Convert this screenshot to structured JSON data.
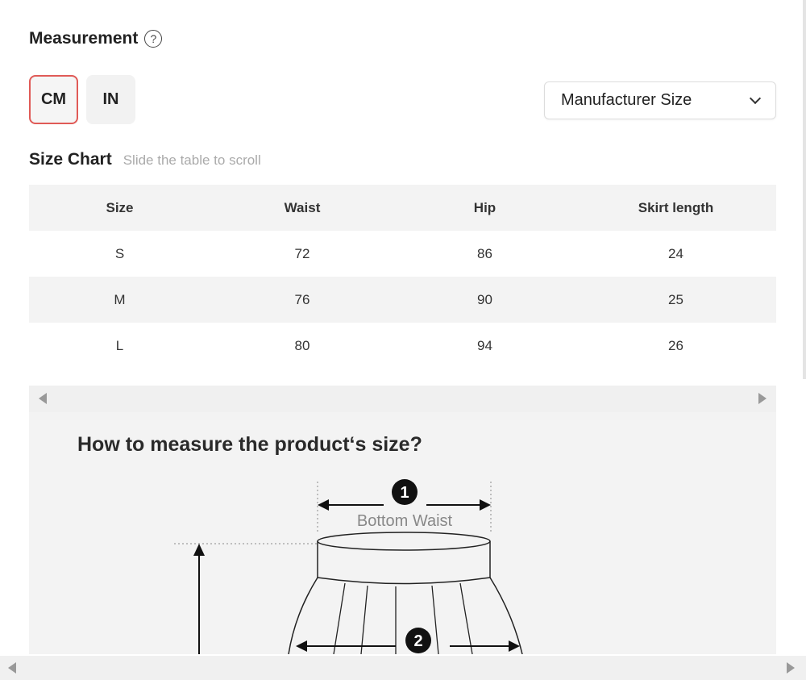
{
  "measurement": {
    "title": "Measurement",
    "help_icon": "?"
  },
  "units": {
    "cm": "CM",
    "in": "IN",
    "selected": "CM"
  },
  "size_select": {
    "value": "Manufacturer Size"
  },
  "size_chart": {
    "title": "Size Chart",
    "hint": "Slide the table to scroll",
    "columns": [
      "Size",
      "Waist",
      "Hip",
      "Skirt length"
    ],
    "rows": [
      [
        "S",
        "72",
        "86",
        "24"
      ],
      [
        "M",
        "76",
        "90",
        "25"
      ],
      [
        "L",
        "80",
        "94",
        "26"
      ]
    ]
  },
  "guide": {
    "title": "How to measure the product‘s size?",
    "marker1": "1",
    "marker2": "2",
    "bottom_waist_label": "Bottom Waist"
  }
}
